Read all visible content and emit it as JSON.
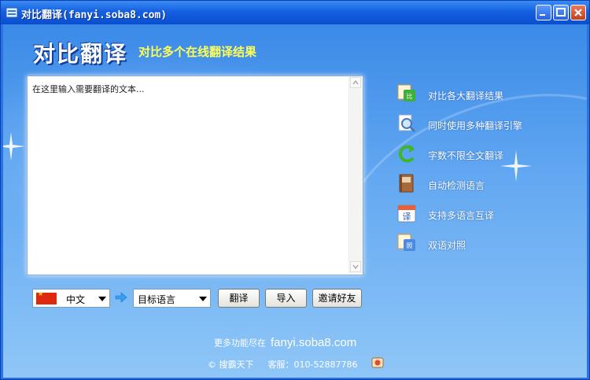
{
  "window": {
    "title": "对比翻译(fanyi.soba8.com)"
  },
  "header": {
    "app_title": "对比翻译",
    "subtitle": "对比多个在线翻译结果"
  },
  "input": {
    "placeholder": "在这里输入需要翻译的文本..."
  },
  "features": [
    {
      "label": "对比各大翻译结果",
      "icon": "compare-icon"
    },
    {
      "label": "同时使用多种翻译引擎",
      "icon": "magnifier-icon"
    },
    {
      "label": "字数不限全文翻译",
      "icon": "refresh-icon"
    },
    {
      "label": "自动检测语言",
      "icon": "book-icon"
    },
    {
      "label": "支持多语言互译",
      "icon": "calendar-translate-icon"
    },
    {
      "label": "双语对照",
      "icon": "bilingual-icon"
    }
  ],
  "controls": {
    "source_lang": "中文",
    "target_lang": "目标语言",
    "translate_button": "翻译",
    "import_button": "导入",
    "invite_button": "邀请好友"
  },
  "footer": {
    "more_label": "更多功能尽在",
    "url": "fanyi.soba8.com",
    "copyright": "© 搜霸天下",
    "service": "客服：010-52887786"
  },
  "colors": {
    "title_yellow": "#ffff55",
    "background_blue": "#3a8ae8",
    "titlebar_blue": "#1460e0"
  }
}
